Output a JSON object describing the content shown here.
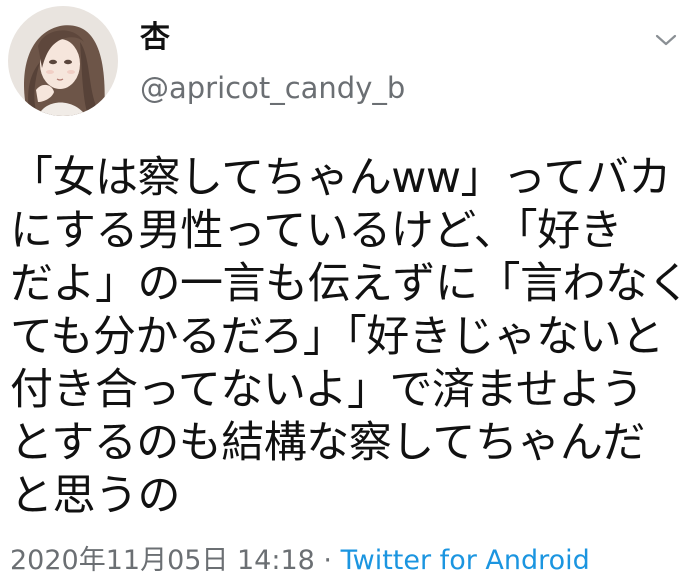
{
  "author": {
    "display_name": "杏",
    "handle": "@apricot_candy_b"
  },
  "icons": {
    "avatar": "profile-illustration",
    "more": "chevron-down-icon"
  },
  "tweet": {
    "lines": [
      "「女は察してちゃんww」ってバカ",
      "にする男性っているけど、「好き",
      "だよ」の一言も伝えずに「言わなく",
      "ても分かるだろ」「好きじゃないと",
      "付き合ってないよ」で済ませよう",
      "とするのも結構な察してちゃんだ",
      "と思うの"
    ]
  },
  "meta": {
    "timestamp": "2020年11月05日 14:18",
    "separator": "·",
    "source": "Twitter for Android"
  },
  "colors": {
    "text": "#111111",
    "secondary": "#6b6f73",
    "link": "#1b95e0",
    "background": "#ffffff"
  }
}
